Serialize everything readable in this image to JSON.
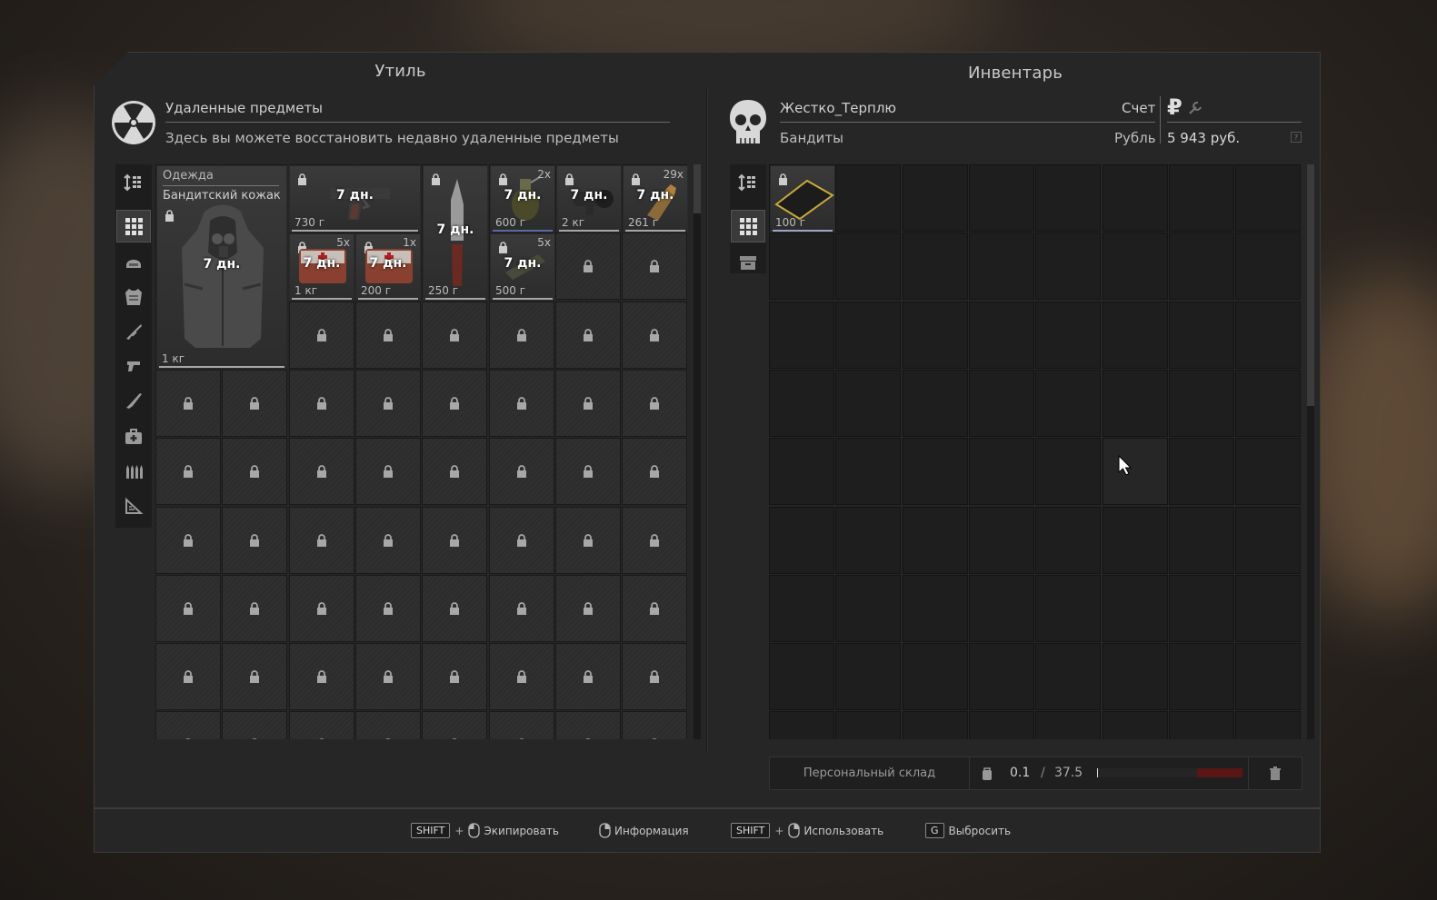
{
  "left_panel": {
    "title": "Утиль",
    "header_title": "Удаленные предметы",
    "header_subtitle": "Здесь вы можете восстановить недавно удаленные предметы",
    "items": [
      {
        "id": "jacket",
        "category": "Одежда",
        "name": "Бандитский кожак",
        "timer": "7 дн.",
        "weight": "1 кг",
        "count": ""
      },
      {
        "id": "pistol",
        "timer": "7 дн.",
        "weight": "730 г",
        "count": ""
      },
      {
        "id": "knife",
        "timer": "7 дн.",
        "weight": "250 г",
        "count": ""
      },
      {
        "id": "grenade",
        "timer": "7 дн.",
        "weight": "600 г",
        "count": "2x"
      },
      {
        "id": "scope",
        "timer": "7 дн.",
        "weight": "2 кг",
        "count": ""
      },
      {
        "id": "ammo",
        "timer": "7 дн.",
        "weight": "261 г",
        "count": "29x"
      },
      {
        "id": "medkit-1",
        "timer": "7 дн.",
        "weight": "1 кг",
        "count": "5x"
      },
      {
        "id": "medkit-2",
        "timer": "7 дн.",
        "weight": "200 г",
        "count": "1x"
      },
      {
        "id": "food",
        "timer": "7 дн.",
        "weight": "500 г",
        "count": "5x"
      }
    ]
  },
  "right_panel": {
    "title": "Инвентарь",
    "player_name": "Жестко_Терплю",
    "faction": "Бандиты",
    "account_label": "Счет",
    "currency_label": "Рубль",
    "balance": "5 943 руб.",
    "currency_symbol": "₽",
    "help_glyph": "?",
    "items": [
      {
        "id": "gold-plate",
        "weight": "100 г"
      }
    ],
    "storage_label": "Персональный склад",
    "weight_current": "0.1",
    "weight_separator": "/",
    "weight_max": "37.5"
  },
  "footer": {
    "hints": [
      {
        "key": "SHIFT",
        "plus": "+",
        "label": "Экипировать"
      },
      {
        "label": "Информация"
      },
      {
        "key": "SHIFT",
        "plus": "+",
        "label": "Использовать"
      },
      {
        "key": "G",
        "label": "Выбросить"
      }
    ]
  },
  "colors": {
    "accent_gold": "#c8a93a",
    "weight_danger": "#6b1a1a",
    "panel_bg": "#262626"
  }
}
